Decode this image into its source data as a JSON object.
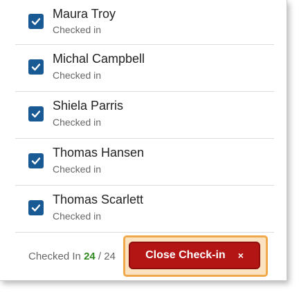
{
  "attendees": [
    {
      "name": "Maura Troy",
      "status": "Checked in"
    },
    {
      "name": "Michal Campbell",
      "status": "Checked in"
    },
    {
      "name": "Shiela Parris",
      "status": "Checked in"
    },
    {
      "name": "Thomas Hansen",
      "status": "Checked in"
    },
    {
      "name": "Thomas Scarlett",
      "status": "Checked in"
    }
  ],
  "footer": {
    "checked_in_label": "Checked In",
    "checked_in_count": "24",
    "separator": "/",
    "total_count": "24",
    "close_label": "Close Check-in",
    "close_icon": "×"
  },
  "colors": {
    "checkbox": "#1a5a94",
    "count_accent": "#2f8a1e",
    "close_button": "#b31515",
    "highlight": "#f0a94a"
  }
}
